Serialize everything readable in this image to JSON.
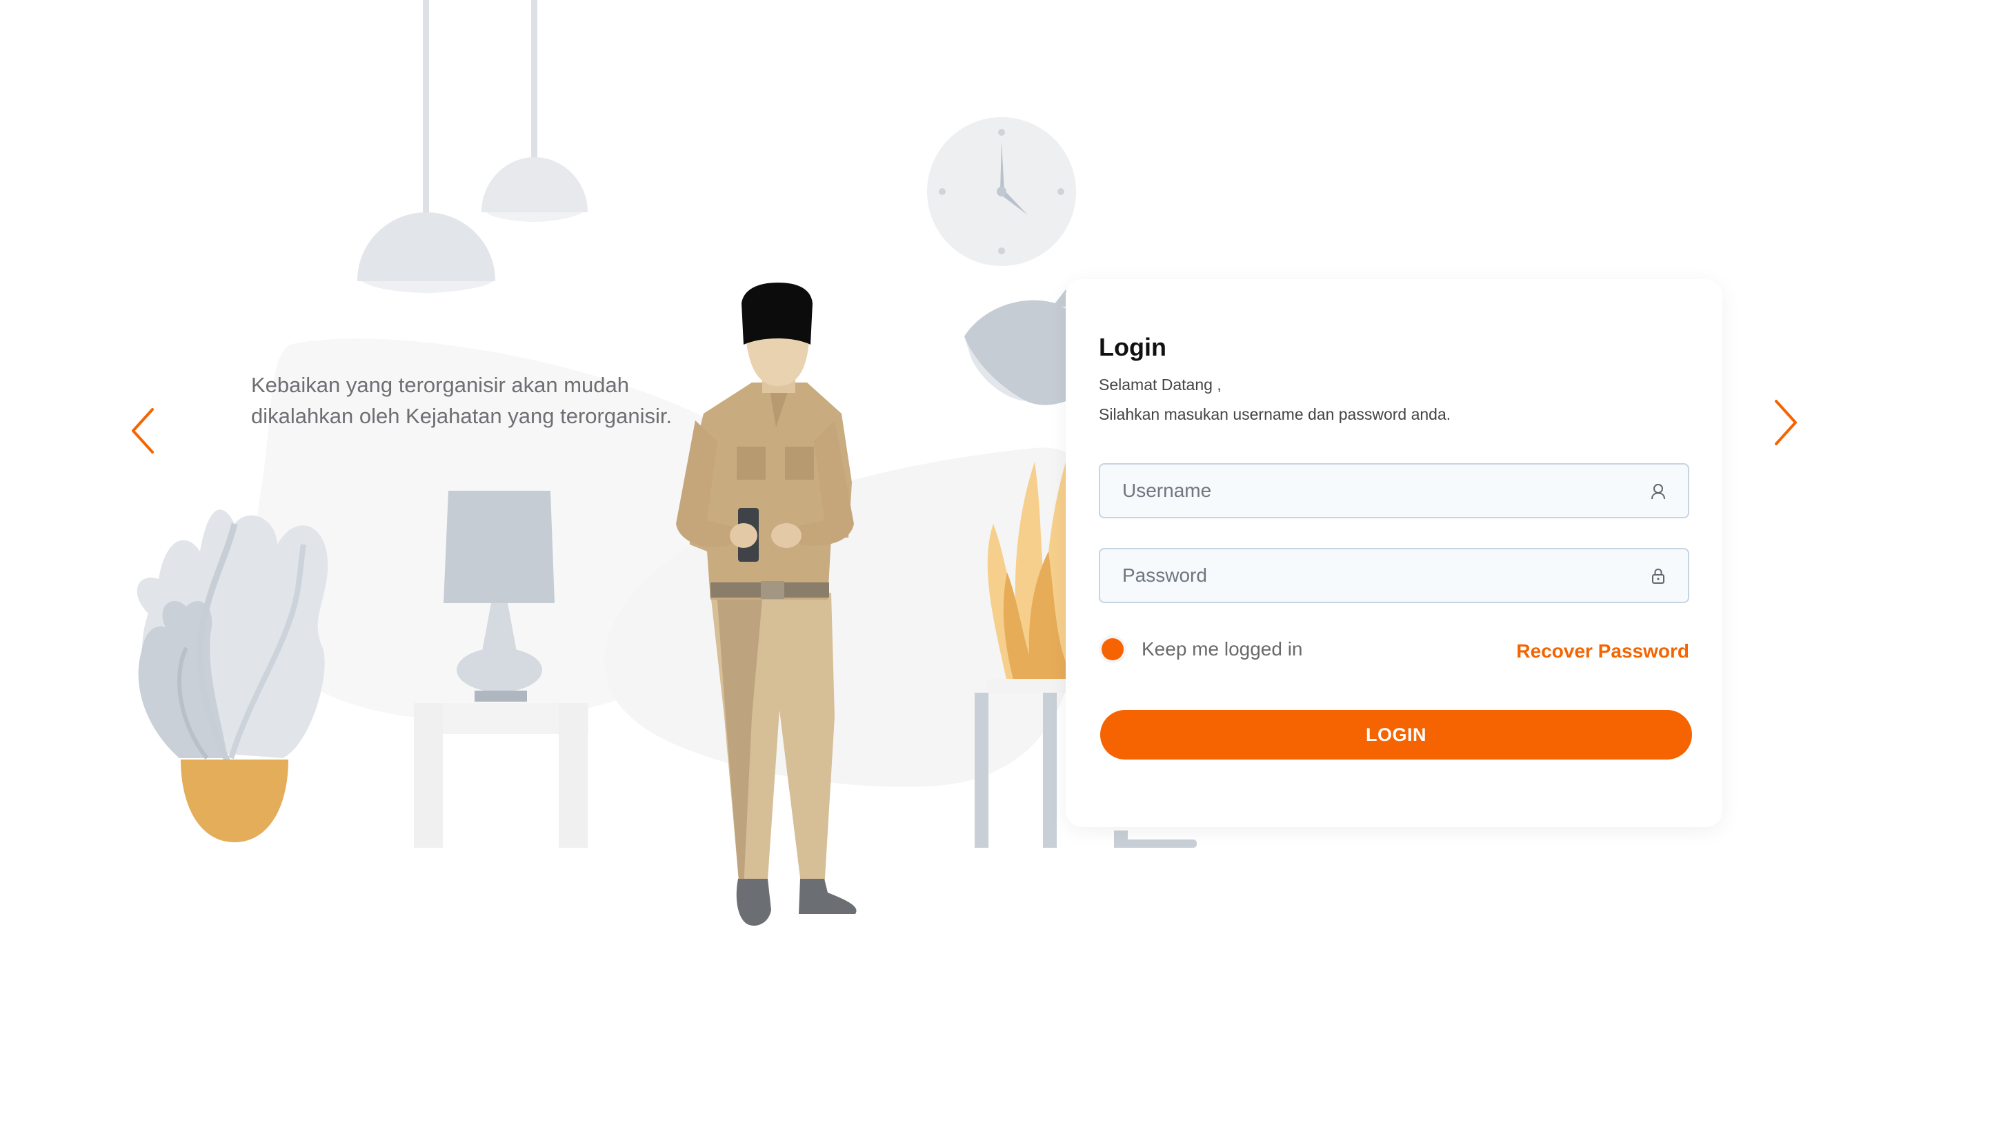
{
  "illustration": {
    "quote": "Kebaikan yang terorganisir akan mudah dikalahkan oleh Kejahatan yang terorganisir.",
    "prev_icon": "chevron-left-icon",
    "next_icon": "chevron-right-icon"
  },
  "login": {
    "title": "Login",
    "greeting_line1": "Selamat Datang ,",
    "greeting_line2": "Silahkan masukan username dan password anda.",
    "username_placeholder": "Username",
    "username_icon": "user-icon",
    "password_placeholder": "Password",
    "password_icon": "lock-icon",
    "remember_label": "Keep me logged in",
    "remember_checked": true,
    "recover_label": "Recover Password",
    "button_label": "LOGIN"
  },
  "colors": {
    "accent": "#f56400",
    "field_border": "#c8d4e2",
    "text_muted": "#6e6e73"
  }
}
